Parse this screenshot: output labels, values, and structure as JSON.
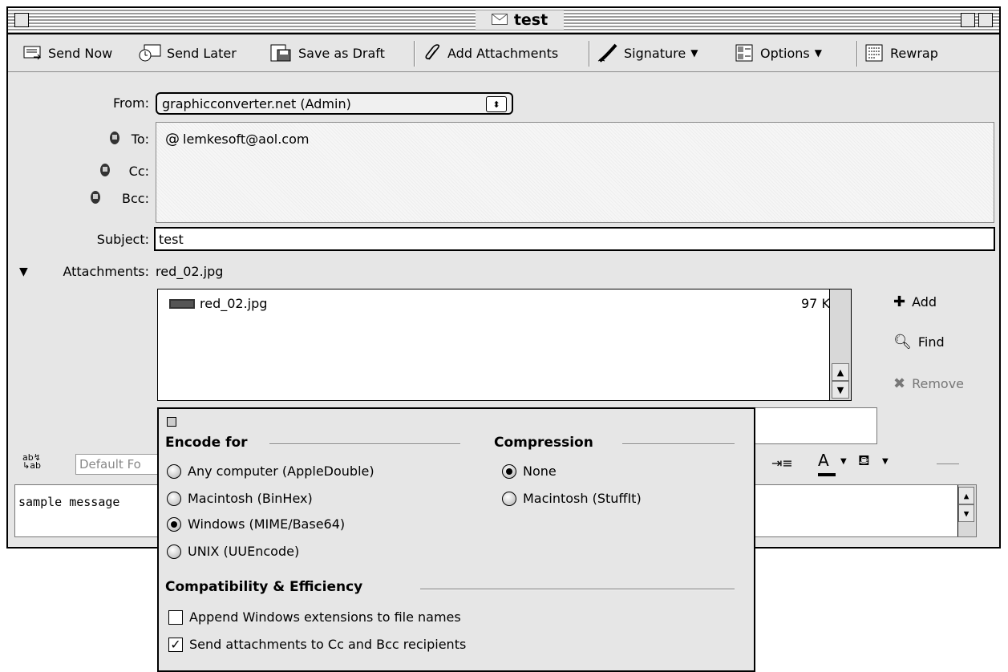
{
  "window": {
    "title": "test"
  },
  "toolbar": {
    "send_now": "Send Now",
    "send_later": "Send Later",
    "save_draft": "Save as Draft",
    "add_attachments": "Add Attachments",
    "signature": "Signature",
    "options": "Options",
    "rewrap": "Rewrap"
  },
  "header": {
    "from_label": "From:",
    "from_value": "graphicconverter.net (Admin)",
    "to_label": "To:",
    "to_value": "lemkesoft@aol.com",
    "cc_label": "Cc:",
    "bcc_label": "Bcc:",
    "subject_label": "Subject:",
    "subject_value": "test"
  },
  "attachments": {
    "label": "Attachments:",
    "summary": "red_02.jpg",
    "items": [
      {
        "name": "red_02.jpg",
        "size": "97 K"
      }
    ],
    "add": "Add",
    "find": "Find",
    "remove": "Remove"
  },
  "format": {
    "font": "Default Fo"
  },
  "message": {
    "body": "sample message"
  },
  "panel": {
    "encode_title": "Encode for",
    "encode_options": [
      {
        "label": "Any computer (AppleDouble)",
        "selected": false
      },
      {
        "label": "Macintosh (BinHex)",
        "selected": false
      },
      {
        "label": "Windows (MIME/Base64)",
        "selected": true
      },
      {
        "label": "UNIX (UUEncode)",
        "selected": false
      }
    ],
    "compression_title": "Compression",
    "compression_options": [
      {
        "label": "None",
        "selected": true
      },
      {
        "label": "Macintosh (StuffIt)",
        "selected": false
      }
    ],
    "compat_title": "Compatibility & Efficiency",
    "checks": [
      {
        "label": "Append Windows extensions to file names",
        "checked": false
      },
      {
        "label": "Send attachments to Cc and Bcc recipients",
        "checked": true
      }
    ]
  }
}
